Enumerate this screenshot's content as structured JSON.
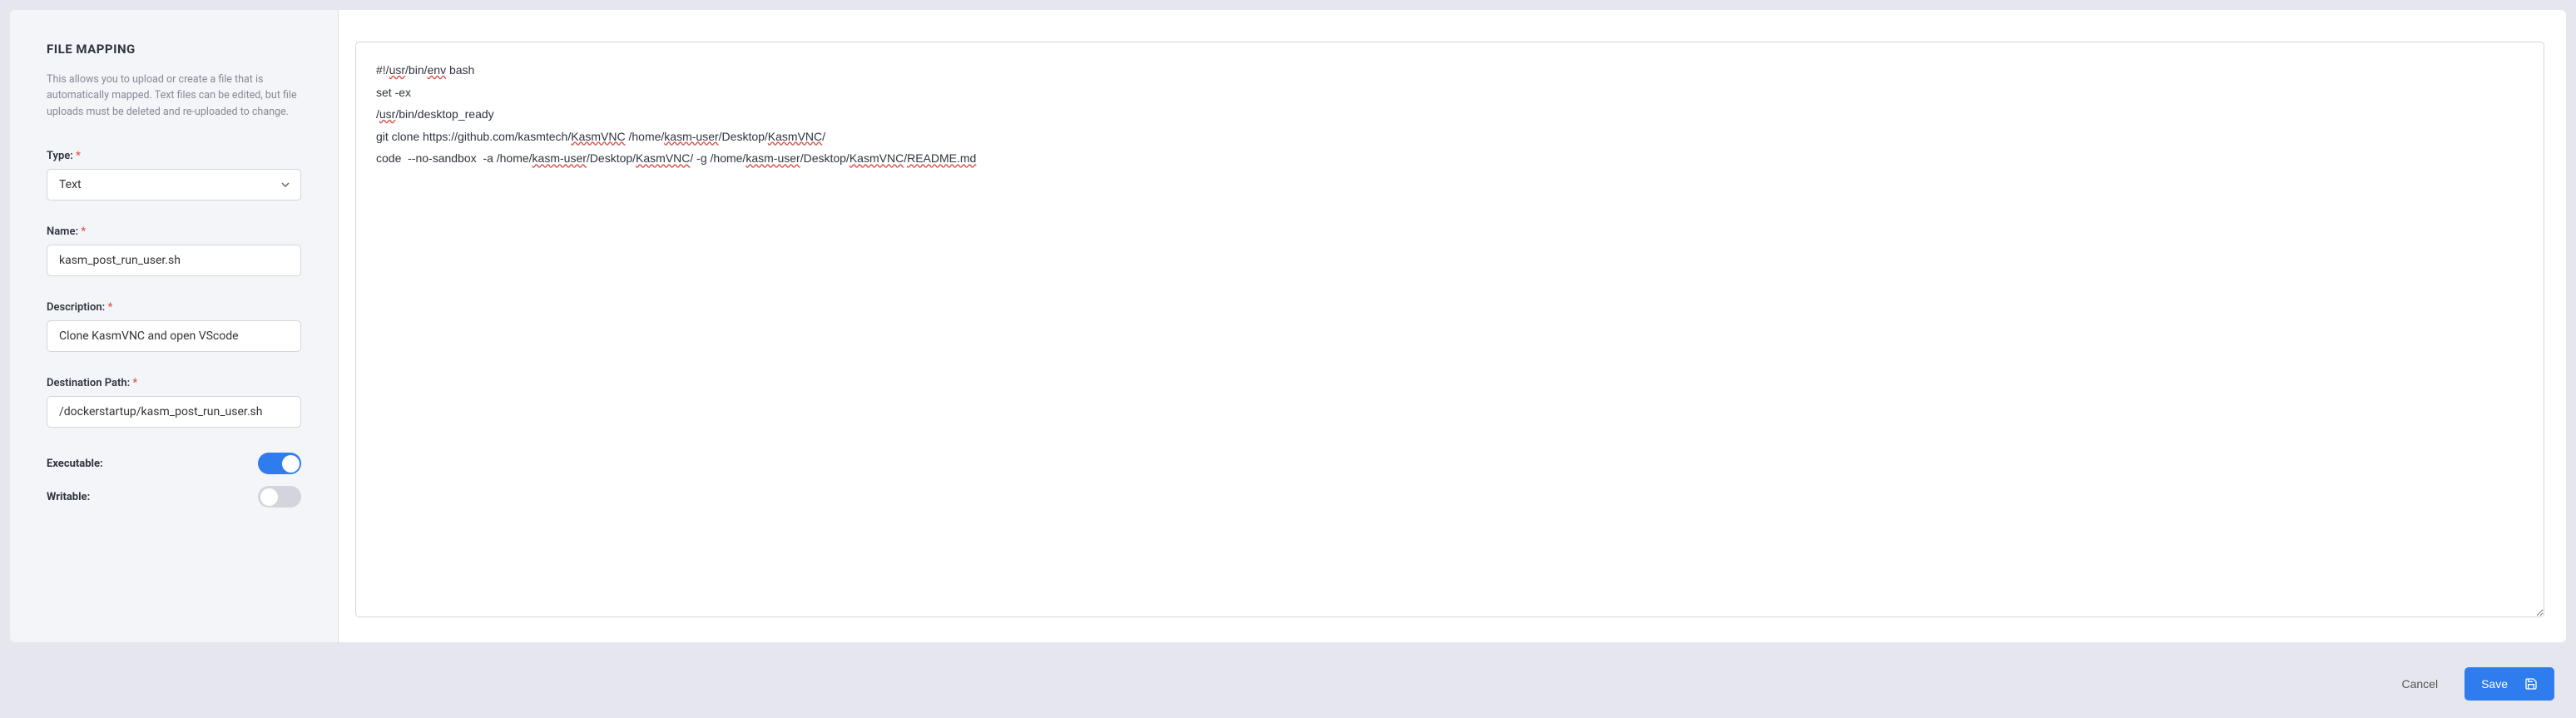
{
  "sidebar": {
    "title": "FILE MAPPING",
    "description": "This allows you to upload or create a file that is automatically mapped. Text files can be edited, but file uploads must be deleted and re-uploaded to change.",
    "fields": {
      "type": {
        "label": "Type:",
        "value": "Text"
      },
      "name": {
        "label": "Name:",
        "value": "kasm_post_run_user.sh"
      },
      "description": {
        "label": "Description:",
        "value": "Clone KasmVNC and open VScode"
      },
      "destination_path": {
        "label": "Destination Path:",
        "value": "/dockerstartup/kasm_post_run_user.sh"
      },
      "executable": {
        "label": "Executable:",
        "value": true
      },
      "writable": {
        "label": "Writable:",
        "value": false
      }
    }
  },
  "editor": {
    "content_plain": "#!/usr/bin/env bash\nset -ex\n/usr/bin/desktop_ready\ngit clone https://github.com/kasmtech/KasmVNC /home/kasm-user/Desktop/KasmVNC/\ncode  --no-sandbox  -a /home/kasm-user/Desktop/KasmVNC/ -g /home/kasm-user/Desktop/KasmVNC/README.md",
    "spell_errors": [
      "usr",
      "env",
      "kasm-user",
      "KasmVNC",
      "README.md"
    ]
  },
  "footer": {
    "cancel_label": "Cancel",
    "save_label": "Save"
  }
}
